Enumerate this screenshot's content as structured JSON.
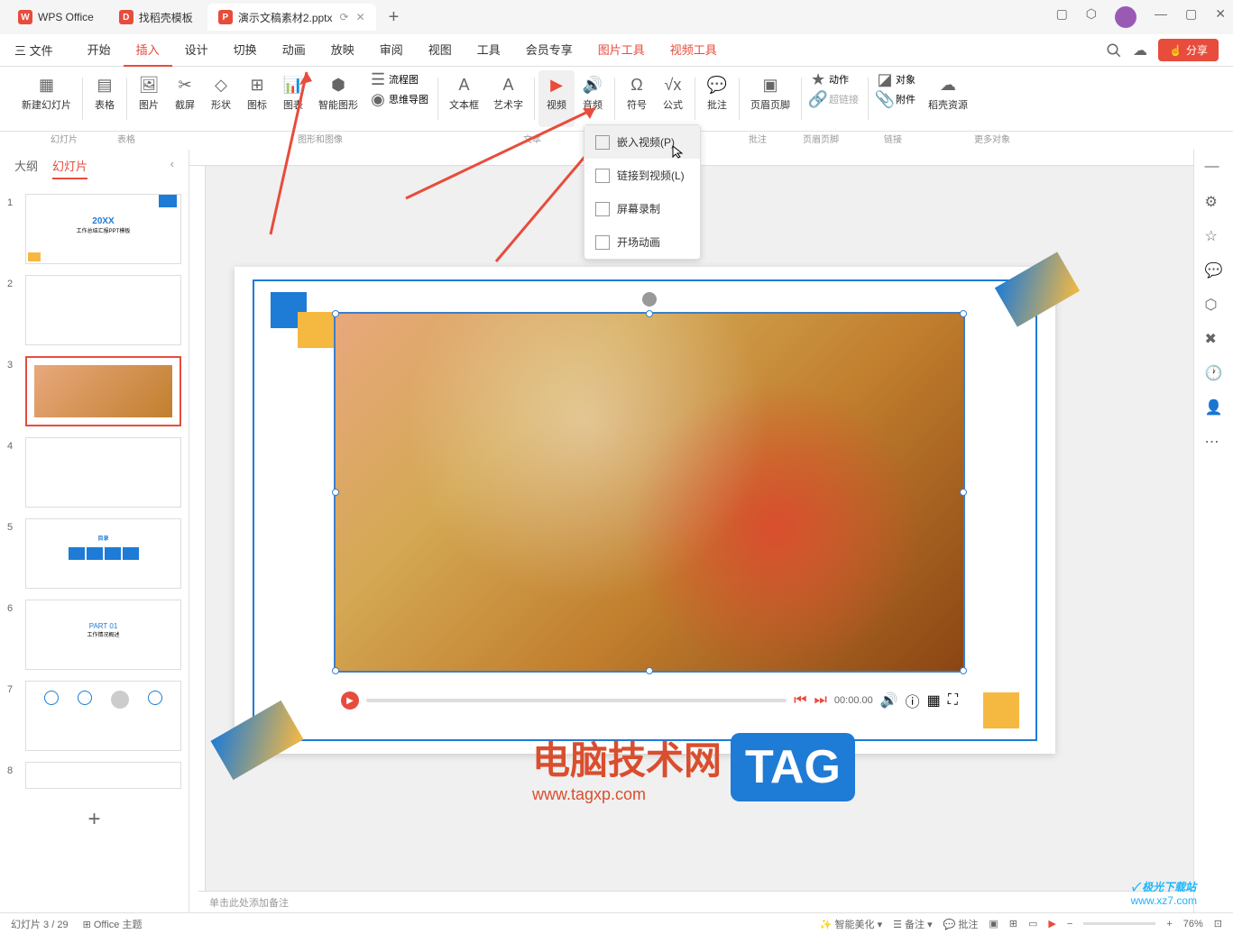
{
  "titlebar": {
    "tabs": [
      {
        "icon": "W",
        "label": "WPS Office"
      },
      {
        "icon": "D",
        "label": "找稻壳模板"
      },
      {
        "icon": "P",
        "label": "演示文稿素材2.pptx"
      }
    ],
    "add": "+"
  },
  "menubar": {
    "file": "三 文件",
    "tabs": [
      "开始",
      "插入",
      "设计",
      "切换",
      "动画",
      "放映",
      "审阅",
      "视图",
      "工具",
      "会员专享",
      "图片工具",
      "视频工具"
    ],
    "active_tab": "插入",
    "share": "分享"
  },
  "ribbon": {
    "groups": [
      {
        "label": "幻灯片",
        "items": [
          {
            "icon": "▦",
            "label": "新建幻灯片"
          }
        ]
      },
      {
        "label": "表格",
        "items": [
          {
            "icon": "▤",
            "label": "表格"
          }
        ]
      },
      {
        "label": "图形和图像",
        "items": [
          {
            "icon": "🖼",
            "label": "图片"
          },
          {
            "icon": "✂",
            "label": "截屏"
          },
          {
            "icon": "◇",
            "label": "形状"
          },
          {
            "icon": "⊞",
            "label": "图标"
          },
          {
            "icon": "📊",
            "label": "图表"
          },
          {
            "icon": "⬢",
            "label": "智能图形"
          },
          {
            "icon": "☰",
            "label": "流程图"
          },
          {
            "icon": "◉",
            "label": "思维导图"
          }
        ]
      },
      {
        "label": "文本",
        "items": [
          {
            "icon": "A",
            "label": "文本框"
          },
          {
            "icon": "A",
            "label": "艺术字"
          }
        ]
      },
      {
        "label": "",
        "items": [
          {
            "icon": "▶",
            "label": "视频"
          },
          {
            "icon": "🔊",
            "label": "音频"
          }
        ]
      },
      {
        "label": "",
        "items": [
          {
            "icon": "Ω",
            "label": "符号"
          },
          {
            "icon": "√x",
            "label": "公式"
          }
        ]
      },
      {
        "label": "批注",
        "items": [
          {
            "icon": "💬",
            "label": "批注"
          }
        ]
      },
      {
        "label": "页眉页脚",
        "items": [
          {
            "icon": "▣",
            "label": "页眉页脚"
          }
        ]
      },
      {
        "label": "链接",
        "items": [
          {
            "icon": "★",
            "label": "动作"
          },
          {
            "icon": "🔗",
            "label": "超链接"
          }
        ]
      },
      {
        "label": "更多对象",
        "items": [
          {
            "icon": "◪",
            "label": "对象"
          },
          {
            "icon": "📎",
            "label": "附件"
          },
          {
            "icon": "☁",
            "label": "稻壳资源"
          }
        ]
      }
    ]
  },
  "dropdown": {
    "items": [
      {
        "icon": "▶",
        "label": "嵌入视频(P)"
      },
      {
        "icon": "🔗",
        "label": "链接到视频(L)"
      },
      {
        "icon": "⏺",
        "label": "屏幕录制"
      },
      {
        "icon": "▶",
        "label": "开场动画"
      }
    ]
  },
  "slide_panel": {
    "tabs": [
      "大纲",
      "幻灯片"
    ],
    "active_tab": "幻灯片",
    "slides": [
      1,
      2,
      3,
      4,
      5,
      6,
      7,
      8
    ],
    "active_slide": 3,
    "thumb1_title": "20XX",
    "thumb1_sub": "工作总结汇报PPT模板",
    "thumb5_title": "目录",
    "thumb6_title": "PART 01",
    "thumb6_sub": "工作情况概述"
  },
  "video": {
    "time": "00:00.00"
  },
  "notes": {
    "placeholder": "单击此处添加备注"
  },
  "statusbar": {
    "slide_info": "幻灯片 3 / 29",
    "theme": "Office 主题",
    "beautify": "智能美化",
    "notes_btn": "备注",
    "comments_btn": "批注",
    "zoom": "76%"
  },
  "brand": {
    "title": "电脑技术网",
    "url": "www.tagxp.com",
    "tag": "TAG"
  },
  "watermark": {
    "name": "极光下载站",
    "url": "www.xz7.com"
  }
}
